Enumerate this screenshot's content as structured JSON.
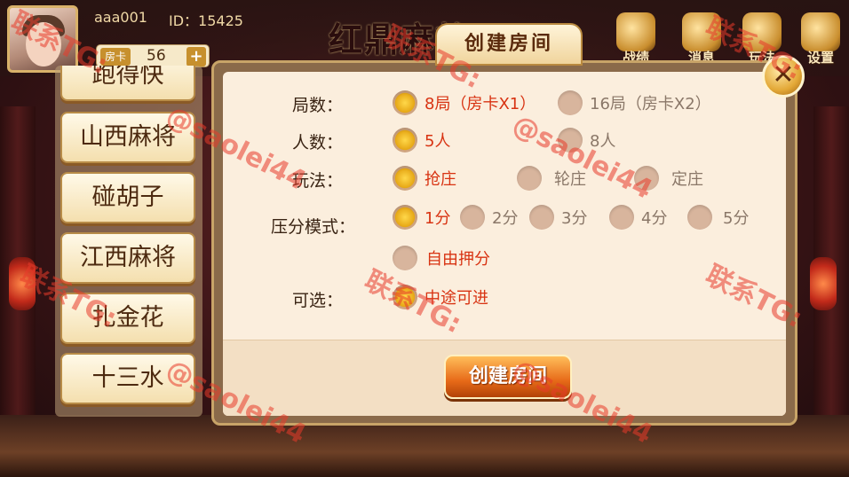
{
  "user": {
    "name": "aaa001",
    "id_label": "ID：15425",
    "card_label": "房卡",
    "card_count": "56",
    "add_symbol": "+"
  },
  "header": {
    "logo_text": "红鼎麻将",
    "nav": [
      {
        "label": "战绩",
        "icon": "trophy-icon"
      },
      {
        "label": "消息",
        "icon": "message-icon"
      },
      {
        "label": "玩法",
        "icon": "rules-icon"
      },
      {
        "label": "设置",
        "icon": "gear-icon"
      }
    ]
  },
  "games": [
    "跑得快",
    "山西麻将",
    "碰胡子",
    "江西麻将",
    "扎金花",
    "十三水"
  ],
  "dialog": {
    "title": "创建房间",
    "close_symbol": "✕",
    "rows": [
      {
        "label": "局数：",
        "options": [
          {
            "text": "8局（房卡X1）",
            "selected": true
          },
          {
            "text": "16局（房卡X2）",
            "selected": false
          }
        ]
      },
      {
        "label": "人数：",
        "options": [
          {
            "text": "5人",
            "selected": true
          },
          {
            "text": "8人",
            "selected": false
          }
        ]
      },
      {
        "label": "玩法：",
        "options": [
          {
            "text": "抢庄",
            "selected": true
          },
          {
            "text": "轮庄",
            "selected": false
          },
          {
            "text": "定庄",
            "selected": false
          }
        ]
      },
      {
        "label": "压分模式：",
        "options": [
          {
            "text": "1分",
            "selected": true
          },
          {
            "text": "2分",
            "selected": false
          },
          {
            "text": "3分",
            "selected": false
          },
          {
            "text": "4分",
            "selected": false
          },
          {
            "text": "5分",
            "selected": false
          },
          {
            "text": "自由押分",
            "selected": false
          }
        ]
      },
      {
        "label": "可选：",
        "options": [
          {
            "text": "中途可进",
            "selected": true
          }
        ]
      }
    ],
    "create_button": "创建房间"
  },
  "watermark": {
    "text_contact": "联系TG:",
    "text_handle": "@saolei44"
  },
  "colors": {
    "selected_text": "#d83312",
    "unselected_text": "#8a7768",
    "watermark": "#e83a2a"
  }
}
